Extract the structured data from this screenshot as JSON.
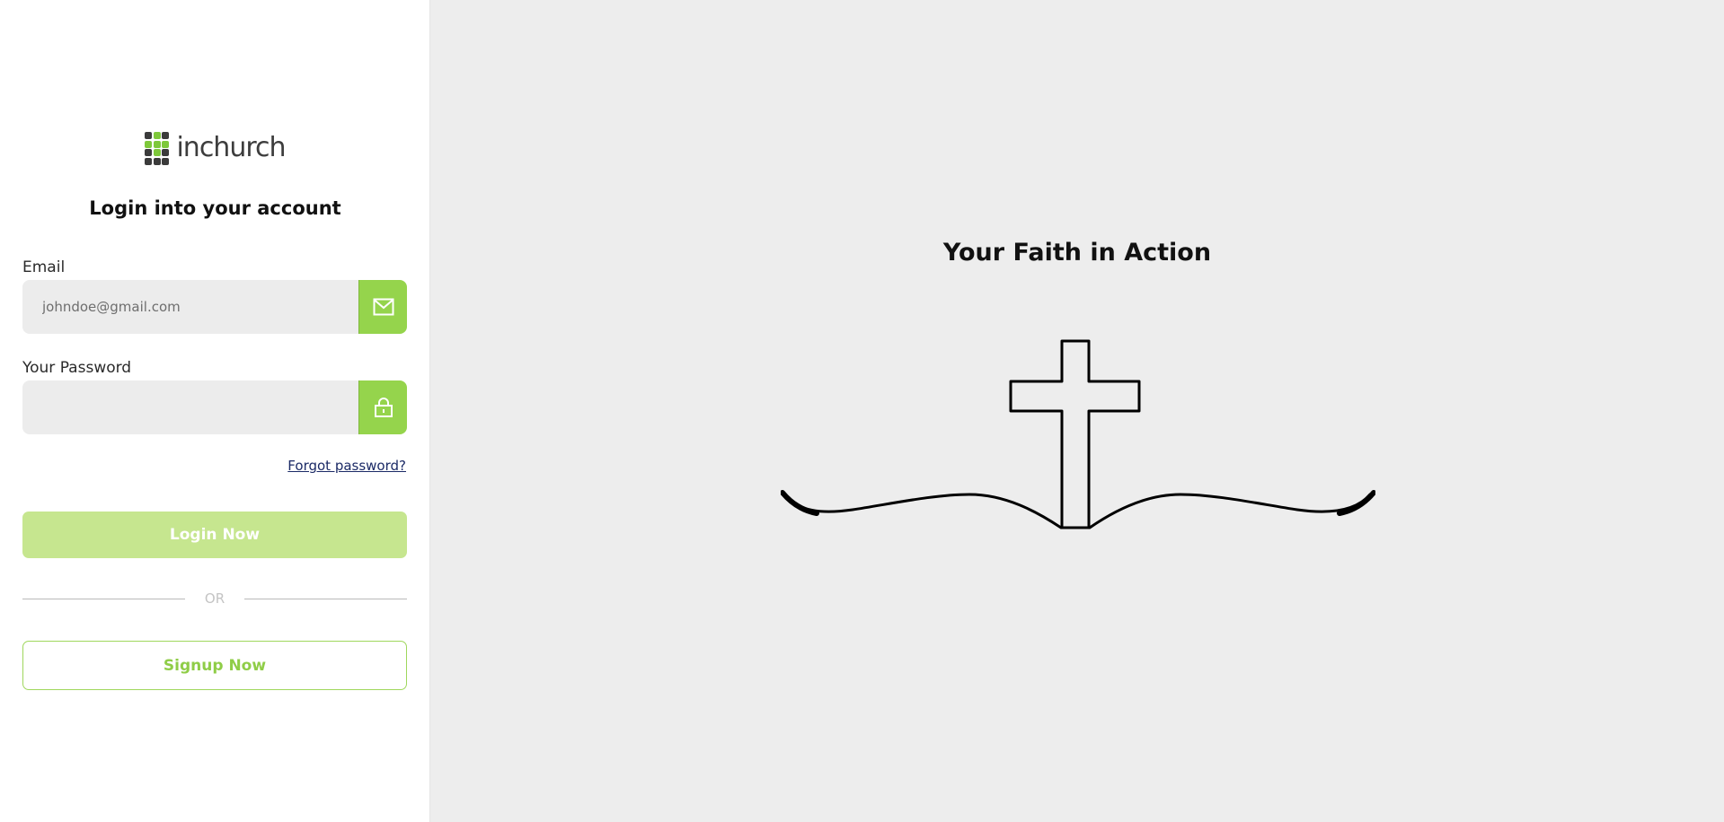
{
  "brand": {
    "name": "inchurch",
    "grid_colors": [
      "#3b3b3b",
      "#7ec83a",
      "#3b3b3b",
      "#7ec83a",
      "#7ec83a",
      "#7ec83a",
      "#3b3b3b",
      "#7ec83a",
      "#3b3b3b",
      "#3b3b3b",
      "#3b3b3b",
      "#3b3b3b"
    ]
  },
  "login": {
    "title": "Login into your account",
    "email_label": "Email",
    "email_placeholder": "johndoe@gmail.com",
    "email_icon": "mail-icon",
    "password_label": "Your Password",
    "password_placeholder": "",
    "password_icon": "lock-icon",
    "forgot_label": "Forgot password?",
    "login_button": "Login Now",
    "or_label": "OR",
    "signup_button": "Signup Now"
  },
  "hero": {
    "tagline": "Your Faith in Action",
    "illustration": "cross-over-open-book"
  },
  "colors": {
    "accent": "#95d44c",
    "accent_light": "#c6e68f",
    "hero_bg": "#ededed",
    "link": "#1b2a66"
  }
}
